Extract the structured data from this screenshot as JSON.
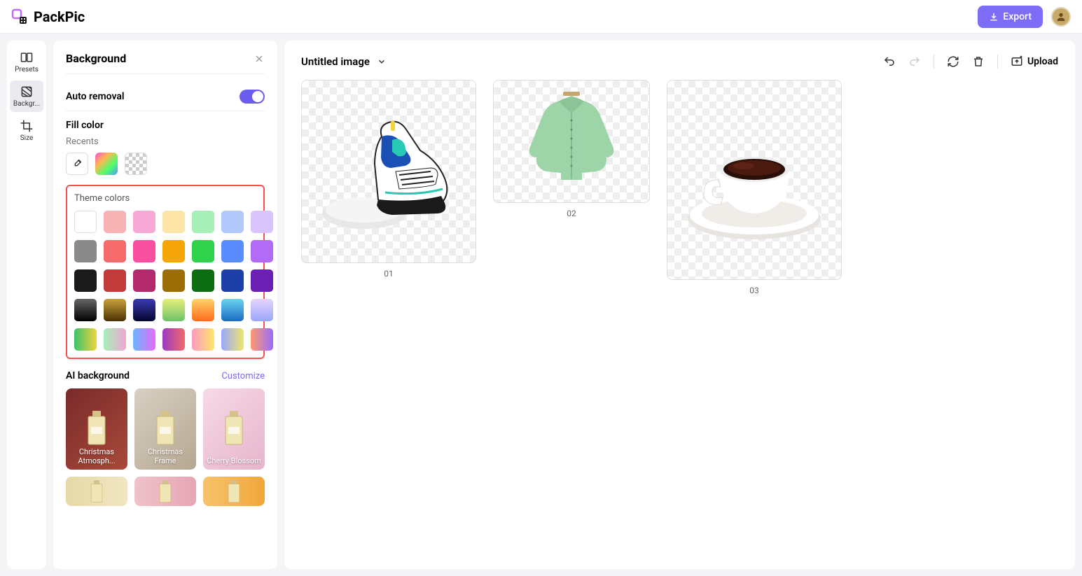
{
  "app": {
    "name": "PackPic",
    "export_label": "Export"
  },
  "rail": {
    "items": [
      {
        "label": "Presets"
      },
      {
        "label": "Backgr..."
      },
      {
        "label": "Size"
      }
    ]
  },
  "panel": {
    "title": "Background",
    "auto_removal_label": "Auto removal",
    "fill_color_label": "Fill color",
    "recents_label": "Recents",
    "theme_colors_label": "Theme colors",
    "theme_colors": {
      "row1": [
        "#ffffff",
        "#f8b4b4",
        "#f7a8d4",
        "#fde5a7",
        "#a6f0b7",
        "#b4c9fb",
        "#d9c5fb"
      ],
      "row2": [
        "#8a8a8a",
        "#f56b6b",
        "#f84fa0",
        "#f7a60a",
        "#2fd24a",
        "#5a8bff",
        "#b26bf7"
      ],
      "row3": [
        "#1a1a1a",
        "#c33a3a",
        "#b32a6c",
        "#9a6e05",
        "#0c6e12",
        "#1c3fa8",
        "#6b1fb5"
      ],
      "row4": [
        "linear-gradient(180deg,#666,#000)",
        "linear-gradient(180deg,#caa23a,#4a3003)",
        "linear-gradient(180deg,#3a3ab5,#05052e)",
        "linear-gradient(180deg,#e6f07a,#6ec26b)",
        "linear-gradient(180deg,#ffd36b,#ff6b1a)",
        "linear-gradient(180deg,#6bd4f0,#1a6bc2)",
        "linear-gradient(180deg,#e6d4fb,#9aa6fb)"
      ],
      "row5": [
        "linear-gradient(90deg,#3ac26b,#f0d43a)",
        "linear-gradient(90deg,#a6f0b7,#f0a6d4)",
        "linear-gradient(90deg,#6bb5ff,#e66bff)",
        "linear-gradient(90deg,#9a3ac2,#f06b6b)",
        "linear-gradient(90deg,#ff9ac2,#ffe66b)",
        "linear-gradient(90deg,#9aa6ff,#f0e66b)",
        "linear-gradient(90deg,#ff9a6b,#9a6bff)"
      ]
    },
    "ai_bg_label": "AI background",
    "customize_label": "Customize",
    "ai_cards": [
      {
        "label": "Christmas Atmosph...",
        "bg": "linear-gradient(135deg,#7a2a2a,#a84a3a)"
      },
      {
        "label": "Christmas Frame",
        "bg": "linear-gradient(135deg,#d9d0c4,#b5a890)"
      },
      {
        "label": "Cherry Blossom",
        "bg": "linear-gradient(135deg,#f7d9e6,#e6b5cc)"
      }
    ],
    "ai_row2_bgs": [
      "linear-gradient(90deg,#e6d9a6,#f0e6c2)",
      "linear-gradient(90deg,#f0c2c9,#e6a6b5)",
      "linear-gradient(90deg,#f7c26b,#f0a63a)"
    ]
  },
  "canvas": {
    "title": "Untitled image",
    "upload_label": "Upload",
    "images": [
      {
        "label": "01"
      },
      {
        "label": "02"
      },
      {
        "label": "03"
      }
    ]
  }
}
